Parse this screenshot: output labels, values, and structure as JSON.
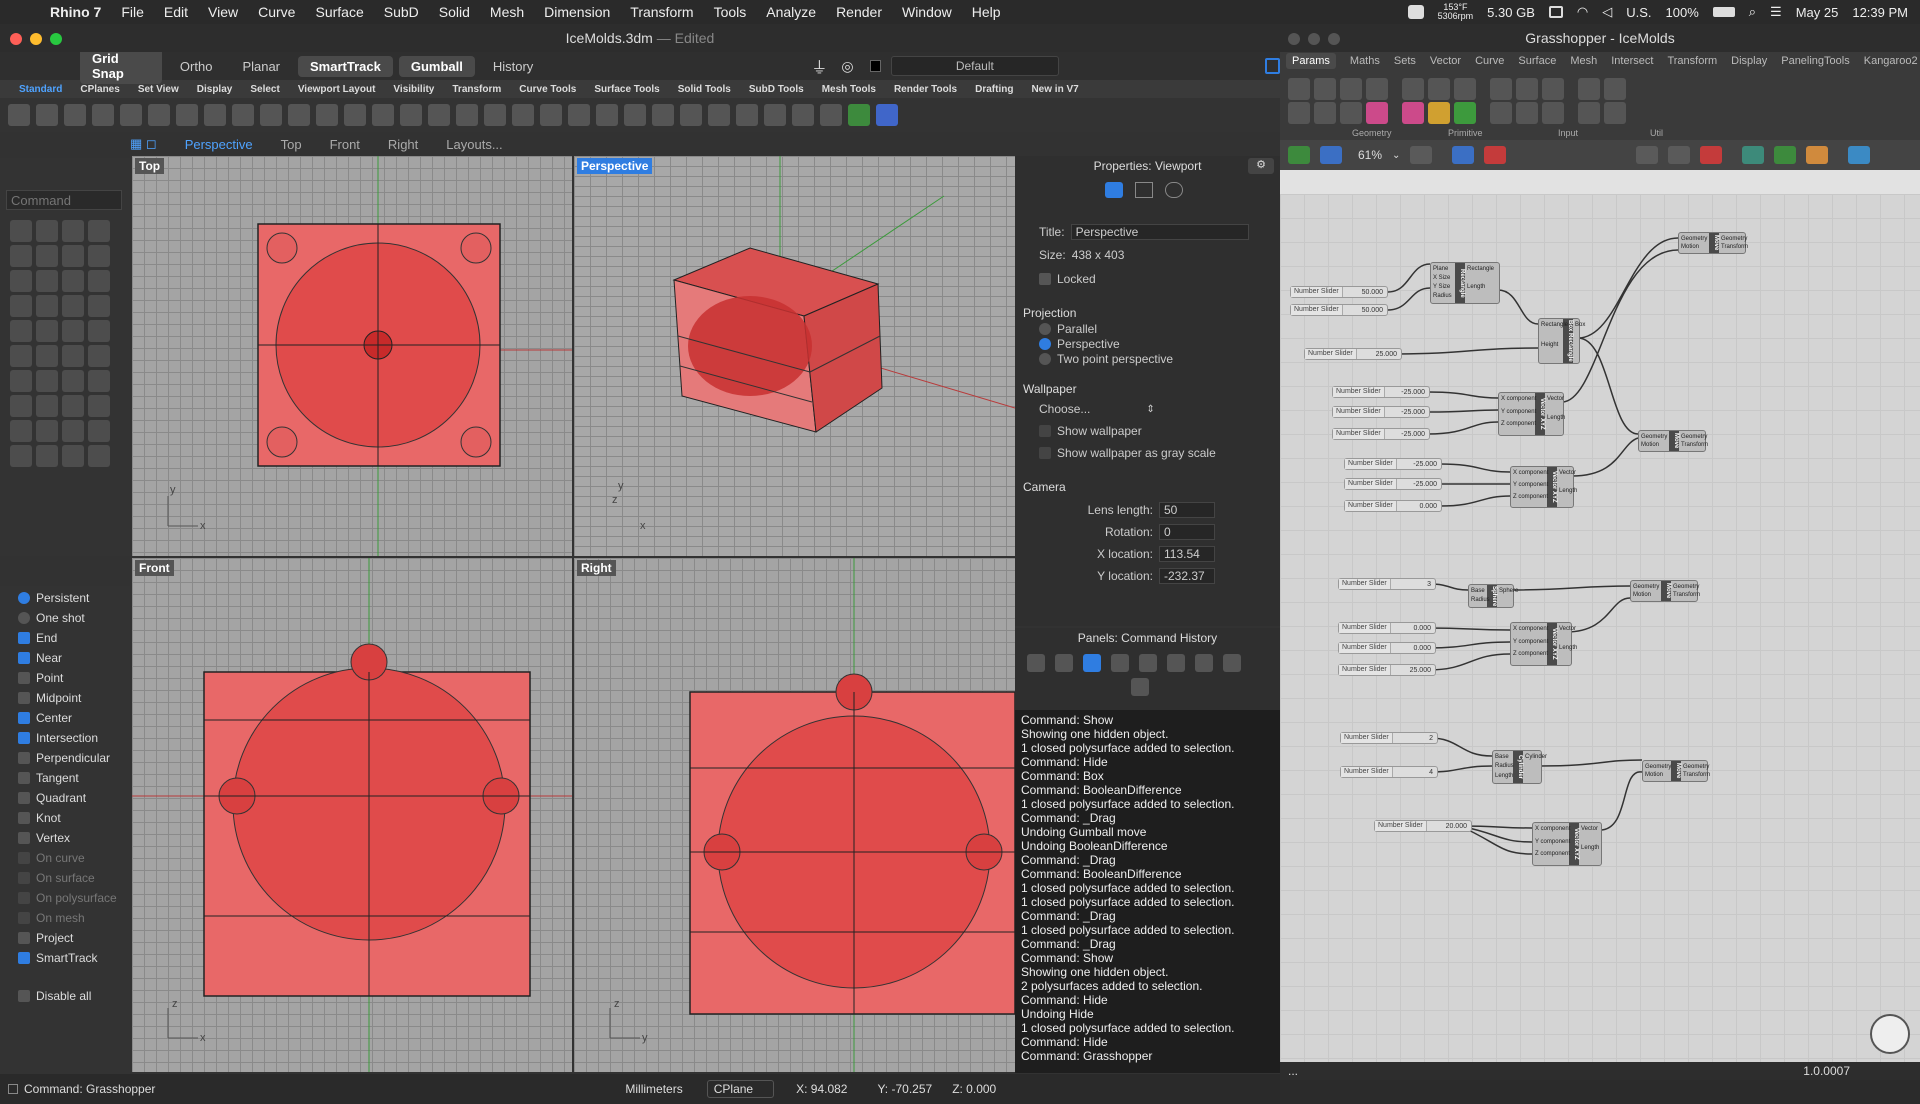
{
  "menubar": {
    "app": "Rhino 7",
    "items": [
      "File",
      "Edit",
      "View",
      "Curve",
      "Surface",
      "SubD",
      "Solid",
      "Mesh",
      "Dimension",
      "Transform",
      "Tools",
      "Analyze",
      "Render",
      "Window",
      "Help"
    ],
    "weather": "153°F",
    "weather2": "5306rpm",
    "memory": "5.30 GB",
    "lang": "U.S.",
    "battery": "100%",
    "date": "May 25",
    "time": "12:39 PM"
  },
  "rhino": {
    "title": "IceMolds.3dm",
    "edited": "— Edited",
    "toggles": [
      "Grid Snap",
      "Ortho",
      "Planar",
      "SmartTrack",
      "Gumball",
      "History"
    ],
    "layer": "Default",
    "tabs": [
      "Standard",
      "CPlanes",
      "Set View",
      "Display",
      "Select",
      "Viewport Layout",
      "Visibility",
      "Transform",
      "Curve Tools",
      "Surface Tools",
      "Solid Tools",
      "SubD Tools",
      "Mesh Tools",
      "Render Tools",
      "Drafting",
      "New in V7"
    ],
    "viewtabs": [
      "Perspective",
      "Top",
      "Front",
      "Right",
      "Layouts..."
    ],
    "command_placeholder": "Command",
    "viewports": {
      "top": "Top",
      "perspective": "Perspective",
      "front": "Front",
      "right": "Right"
    },
    "axes": {
      "y": "y",
      "x": "x",
      "z": "z"
    },
    "osnap": [
      {
        "label": "Persistent",
        "state": "radio-on"
      },
      {
        "label": "One shot",
        "state": "radio"
      },
      {
        "label": "End",
        "state": "on"
      },
      {
        "label": "Near",
        "state": "on"
      },
      {
        "label": "Point",
        "state": "off"
      },
      {
        "label": "Midpoint",
        "state": "off"
      },
      {
        "label": "Center",
        "state": "on"
      },
      {
        "label": "Intersection",
        "state": "on"
      },
      {
        "label": "Perpendicular",
        "state": "off"
      },
      {
        "label": "Tangent",
        "state": "off"
      },
      {
        "label": "Quadrant",
        "state": "off"
      },
      {
        "label": "Knot",
        "state": "off"
      },
      {
        "label": "Vertex",
        "state": "off"
      },
      {
        "label": "On curve",
        "state": "dim"
      },
      {
        "label": "On surface",
        "state": "dim"
      },
      {
        "label": "On polysurface",
        "state": "dim"
      },
      {
        "label": "On mesh",
        "state": "dim"
      },
      {
        "label": "Project",
        "state": "off"
      },
      {
        "label": "SmartTrack",
        "state": "on"
      },
      {
        "label": "Disable all",
        "state": "off"
      }
    ]
  },
  "props": {
    "header": "Properties: Viewport",
    "title_label": "Title:",
    "title_value": "Perspective",
    "size_label": "Size:",
    "size_value": "438 x 403",
    "locked": "Locked",
    "projection": "Projection",
    "parallel": "Parallel",
    "perspective": "Perspective",
    "two_point": "Two point perspective",
    "wallpaper": "Wallpaper",
    "choose": "Choose...",
    "show_wallpaper": "Show wallpaper",
    "show_gray": "Show wallpaper as gray scale",
    "camera": "Camera",
    "lens_label": "Lens length:",
    "lens": "50",
    "rotation_label": "Rotation:",
    "rotation": "0",
    "xloc_label": "X location:",
    "xloc": "113.54",
    "yloc_label": "Y location:",
    "yloc": "-232.37"
  },
  "history": {
    "header": "Panels: Command History",
    "lines": [
      "Command: Show",
      "Showing one hidden object.",
      "1 closed polysurface added to selection.",
      "Command: Hide",
      "Command: Box",
      "Command: BooleanDifference",
      "1 closed polysurface added to selection.",
      "Command: _Drag",
      "Undoing Gumball move",
      "Undoing BooleanDifference",
      "Command: _Drag",
      "Command: BooleanDifference",
      "1 closed polysurface added to selection.",
      "1 closed polysurface added to selection.",
      "Command: _Drag",
      "1 closed polysurface added to selection.",
      "Command: _Drag",
      "Command: Show",
      "Showing one hidden object.",
      "2 polysurfaces added to selection.",
      "Command: Hide",
      "Undoing Hide",
      "1 closed polysurface added to selection.",
      "Command: Hide",
      "Command: Grasshopper"
    ]
  },
  "status": {
    "command": "Command: Grasshopper",
    "units": "Millimeters",
    "cplane": "CPlane",
    "x": "X: 94.082",
    "y": "Y: -70.257",
    "z": "Z: 0.000"
  },
  "gh": {
    "title": "Grasshopper - IceMolds",
    "tabs": [
      "Params",
      "Maths",
      "Sets",
      "Vector",
      "Curve",
      "Surface",
      "Mesh",
      "Intersect",
      "Transform",
      "Display",
      "PanelingTools",
      "Kangaroo2"
    ],
    "groups": [
      "Geometry",
      "Primitive",
      "Input",
      "Util"
    ],
    "zoom": "61%",
    "version": "1.0.0007",
    "slider_label": "Number Slider",
    "sliders": [
      "50.000",
      "50.000",
      "25.000",
      "-25.000",
      "-25.000",
      "-25.000",
      "-25.000",
      "-25.000",
      "0.000",
      "3",
      "0.000",
      "0.000",
      "25.000",
      "2",
      "4",
      "20.000"
    ],
    "components": {
      "rect": {
        "name": "Rectangle",
        "in": [
          "Plane",
          "X Size",
          "Y Size",
          "Radius"
        ],
        "out": [
          "Rectangle",
          "Length"
        ]
      },
      "box": {
        "name": "Box Rectangle",
        "in": [
          "Rectangle",
          "Height"
        ],
        "out": [
          "Box"
        ]
      },
      "vec": {
        "name": "Vector XYZ",
        "in": [
          "X component",
          "Y component",
          "Z component"
        ],
        "out": [
          "Vector",
          "Length"
        ]
      },
      "move": {
        "name": "Move",
        "in": [
          "Geometry",
          "Motion"
        ],
        "out": [
          "Geometry",
          "Transform"
        ]
      },
      "sphere": {
        "name": "Sphere",
        "in": [
          "Base",
          "Radius"
        ],
        "out": [
          "Sphere"
        ]
      },
      "cyl": {
        "name": "Cylinder",
        "in": [
          "Base",
          "Radius",
          "Length"
        ],
        "out": [
          "Cylinder"
        ]
      }
    }
  }
}
